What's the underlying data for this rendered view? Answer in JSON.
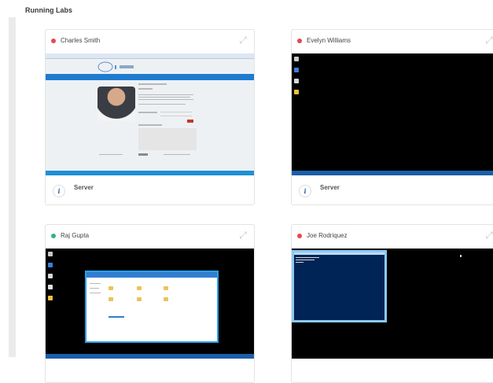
{
  "section": {
    "title": "Running Labs"
  },
  "labs": [
    {
      "user": "Charles Smith",
      "status": "red",
      "footer_label": "Server",
      "screen": "browser"
    },
    {
      "user": "Evelyn Williams",
      "status": "red",
      "footer_label": "Server",
      "screen": "desktop"
    },
    {
      "user": "Raj Gupta",
      "status": "green",
      "screen": "file-explorer"
    },
    {
      "user": "Joe Rodriquez",
      "status": "red",
      "screen": "console"
    }
  ],
  "icons": {
    "status": "status-dot-icon",
    "expand": "expand-icon",
    "info": "info-icon"
  },
  "colors": {
    "status_red": "#e8484f",
    "status_green": "#2fb67f",
    "accent_blue": "#1e7bd0",
    "info_blue": "#2a64b0"
  },
  "info_glyph": "i"
}
